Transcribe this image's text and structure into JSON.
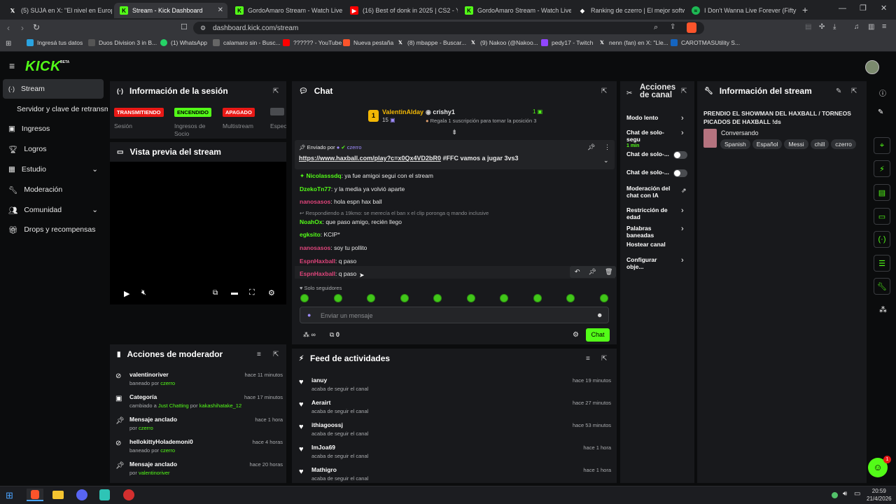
{
  "browser": {
    "tabs": [
      {
        "title": "(5) SUJA en X: \"El nivel en Europa es",
        "icon": "x-icon",
        "active": false
      },
      {
        "title": "Stream - Kick Dashboard",
        "icon": "kick-icon",
        "active": true
      },
      {
        "title": "GordoAmaro Stream - Watch Live o",
        "icon": "kick-icon",
        "active": false
      },
      {
        "title": "(16) Best of donk in 2025 | CS2 - You",
        "icon": "youtube-icon",
        "active": false
      },
      {
        "title": "GordoAmaro Stream - Watch Live",
        "icon": "kick-icon",
        "active": false
      },
      {
        "title": "Ranking de czerro | El mejor softwa",
        "icon": "rank-icon",
        "active": false
      },
      {
        "title": "I Don't Wanna Live Forever (Fifty",
        "icon": "spotify-icon",
        "active": false
      }
    ],
    "url": "dashboard.kick.com/stream",
    "bookmarks": [
      {
        "label": "Ingresá tus datos",
        "color": "#2aa3e0"
      },
      {
        "label": "Duos Division 3 in B...",
        "color": "#444"
      },
      {
        "label": "(1) WhatsApp",
        "color": "#25d366"
      },
      {
        "label": "calamaro sin - Busc...",
        "color": "#555"
      },
      {
        "label": "?????? - YouTube",
        "color": "#ff0000"
      },
      {
        "label": "Nueva pestaña",
        "color": "#fb542b"
      },
      {
        "label": "(8) mbappe - Buscar...",
        "color": "#000"
      },
      {
        "label": "(9) Nakoo (@Nakoo...",
        "color": "#000"
      },
      {
        "label": "pedy17 - Twitch",
        "color": "#9146ff"
      },
      {
        "label": "nenn (fan) en X: \"Lle...",
        "color": "#000"
      },
      {
        "label": "CAROTMASUtility S...",
        "color": "#1565c0"
      }
    ]
  },
  "kick": {
    "logo": "KICK",
    "beta": "BETA"
  },
  "sidebar": {
    "items": [
      {
        "label": "Stream",
        "icon": "stream-icon"
      },
      {
        "label": "Servidor y clave de retransmisión",
        "icon": ""
      },
      {
        "label": "Ingresos",
        "icon": "income-icon"
      },
      {
        "label": "Logros",
        "icon": "trophy-icon"
      },
      {
        "label": "Estudio",
        "icon": "studio-icon"
      },
      {
        "label": "Moderación",
        "icon": "wrench-icon"
      },
      {
        "label": "Comunidad",
        "icon": "community-icon"
      },
      {
        "label": "Drops y recompensas",
        "icon": "drops-icon"
      }
    ]
  },
  "session": {
    "title": "Información de la sesión",
    "stats": [
      {
        "badge": "TRANSMITIENDO",
        "label": "Sesión",
        "color": "#e91916"
      },
      {
        "badge": "ENCENDIDO",
        "label": "Ingresos de Socio",
        "color": "#53fc18"
      },
      {
        "badge": "APAGADO",
        "label": "Multistream",
        "color": "#e91916"
      },
      {
        "badge": "",
        "label": "Espect",
        "color": "#555"
      }
    ]
  },
  "preview": {
    "title": "Vista previa del stream"
  },
  "modactions": {
    "title": "Acciones de moderador",
    "items": [
      {
        "title": "valentinoriver",
        "sub1": "baneado por",
        "sub2": "czerro",
        "time": "hace 11 minutos",
        "icon": "ban-icon"
      },
      {
        "title": "Categoría",
        "sub1": "cambiado a",
        "sub2": "Just Chatting",
        "sub3": "por",
        "sub4": "kakashihatake_12",
        "time": "hace 17 minutos",
        "icon": "category-icon"
      },
      {
        "title": "Mensaje anclado",
        "sub1": "por",
        "sub2": "czerro",
        "time": "hace 1 hora",
        "icon": "pin-icon"
      },
      {
        "title": "hellokittyHoIademoni0",
        "sub1": "baneado por",
        "sub2": "czerro",
        "time": "hace 4 horas",
        "icon": "ban-icon"
      },
      {
        "title": "Mensaje anclado",
        "sub1": "por",
        "sub2": "valentinoriver",
        "time": "hace 20 horas",
        "icon": "pin-icon"
      }
    ]
  },
  "chat": {
    "title": "Chat",
    "gifter1": {
      "name": "ValentinAlday",
      "count": "15"
    },
    "gifter2": {
      "name": "crishy1",
      "count": "1"
    },
    "gift_note": "Regala 1 suscripción para tomar la posición 3",
    "pinned": {
      "label": "Enviado por",
      "by": "czerro",
      "link": "https://www.haxball.com/play?c=x0Qx4VD2bR0",
      "text": "#FFC vamos a jugar 3vs3"
    },
    "messages": [
      {
        "user": "Nicolasssdq",
        "color": "#53fc18",
        "text": ": ya fue amigoi segui con el stream"
      },
      {
        "user": "DzekoTn77",
        "color": "#53fc18",
        "text": ": y la media ya volvió aparte"
      },
      {
        "user": "nanosasos",
        "color": "#e0457b",
        "text": ": hola espn hax ball"
      },
      {
        "user": "NoahOx",
        "color": "#53fc18",
        "text": ": que paso amigo, recién llego"
      },
      {
        "user": "egksito",
        "color": "#53fc18",
        "text": ": KCIP*"
      },
      {
        "user": "nanosasos",
        "color": "#e0457b",
        "text": ": soy tu pollito"
      },
      {
        "user": "EspnHaxball",
        "color": "#e0457b",
        "text": ": q paso"
      },
      {
        "user": "EspnHaxball",
        "color": "#e0457b",
        "text": ": q paso"
      }
    ],
    "reply_note": "Respondiendo a 19kmo: se merecía el ban x el clip poronga q mando inclusive",
    "followers_only": "Solo seguidores",
    "input_placeholder": "Enviar un mensaje",
    "points": "∞",
    "gifts": "0",
    "send_label": "Chat"
  },
  "channel_actions": {
    "title": "Acciones de canal",
    "items": [
      {
        "label": "Modo lento",
        "sub": "",
        "control": "chevron"
      },
      {
        "label": "Chat de solo-segu",
        "sub": "1 min",
        "control": "chevron"
      },
      {
        "label": "Chat de solo-...",
        "sub": "",
        "control": "toggle"
      },
      {
        "label": "Chat de solo-...",
        "sub": "",
        "control": "toggle"
      },
      {
        "label": "Moderación del chat con IA",
        "sub": "",
        "control": "external"
      },
      {
        "label": "Restricción de edad",
        "sub": "",
        "control": "chevron"
      },
      {
        "label": "Palabras baneadas",
        "sub": "",
        "control": "chevron"
      },
      {
        "label": "Hostear canal",
        "sub": "",
        "control": "none"
      },
      {
        "label": "Configurar obje...",
        "sub": "",
        "control": "chevron"
      }
    ]
  },
  "stream_info": {
    "title": "Información del stream",
    "stream_title": "PRENDIO EL SHOWMAN DEL HAXBALL / TORNEOS PICADOS DE HAXBALL !ds",
    "category": "Conversando",
    "tags": [
      "Spanish",
      "Español",
      "Messi",
      "chill",
      "czerro"
    ]
  },
  "feed": {
    "title": "Feed de actividades",
    "items": [
      {
        "user": "ianuy",
        "action": "acaba de seguir el canal",
        "time": "hace 19 minutos"
      },
      {
        "user": "Aerairt",
        "action": "acaba de seguir el canal",
        "time": "hace 27 minutos"
      },
      {
        "user": "ithiagoossj",
        "action": "acaba de seguir el canal",
        "time": "hace 53 minutos"
      },
      {
        "user": "ImJoa69",
        "action": "acaba de seguir el canal",
        "time": "hace 1 hora"
      },
      {
        "user": "Mathigro",
        "action": "acaba de seguir el canal",
        "time": "hace 1 hora"
      }
    ]
  },
  "taskbar": {
    "time": "20:59",
    "date": "21/4/2026",
    "notif": "1"
  }
}
